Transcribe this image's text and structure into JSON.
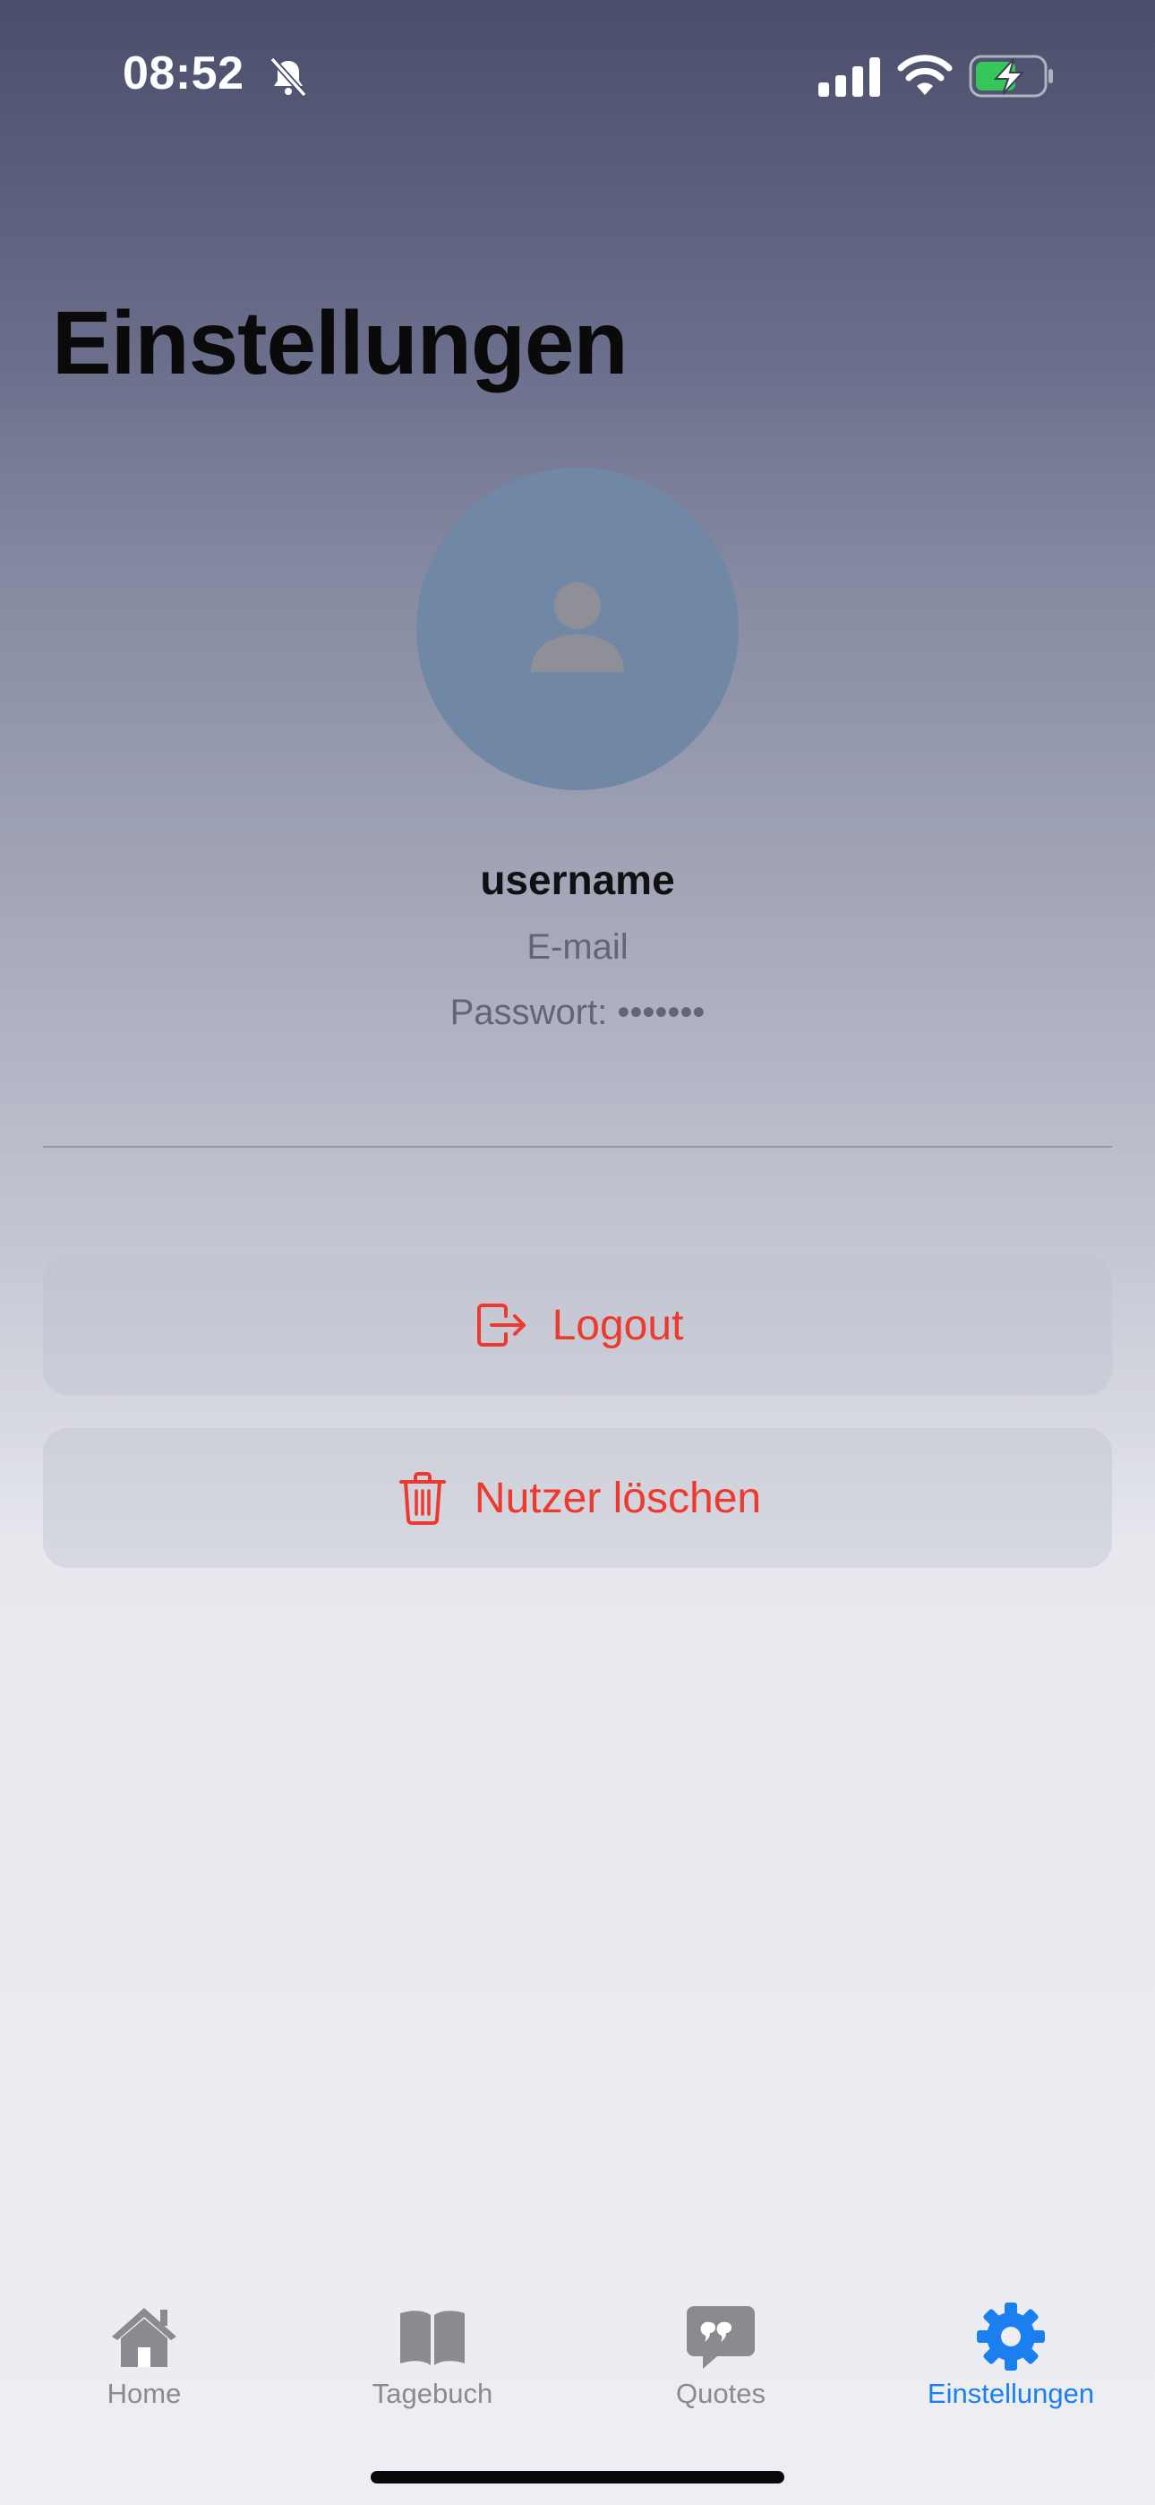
{
  "status_bar": {
    "time": "08:52",
    "icons": [
      "bell-slash-icon",
      "cellular-signal-icon",
      "wifi-icon",
      "battery-charging-icon"
    ]
  },
  "page": {
    "title": "Einstellungen"
  },
  "profile": {
    "avatar_icon": "person-icon",
    "username": "username",
    "email": "E-mail",
    "password": "Passwort: •••••••"
  },
  "actions": {
    "logout_label": "Logout",
    "logout_icon": "logout-icon",
    "delete_label": "Nutzer löschen",
    "delete_icon": "trash-icon",
    "color": "#ee3a2e"
  },
  "tab_bar": {
    "items": [
      {
        "label": "Home",
        "icon": "house-icon",
        "active": false
      },
      {
        "label": "Tagebuch",
        "icon": "book-icon",
        "active": false
      },
      {
        "label": "Quotes",
        "icon": "quote-bubble-icon",
        "active": false
      },
      {
        "label": "Einstellungen",
        "icon": "gear-icon",
        "active": true
      }
    ],
    "active_color": "#1b7ff0",
    "inactive_color": "#8a8a90"
  }
}
